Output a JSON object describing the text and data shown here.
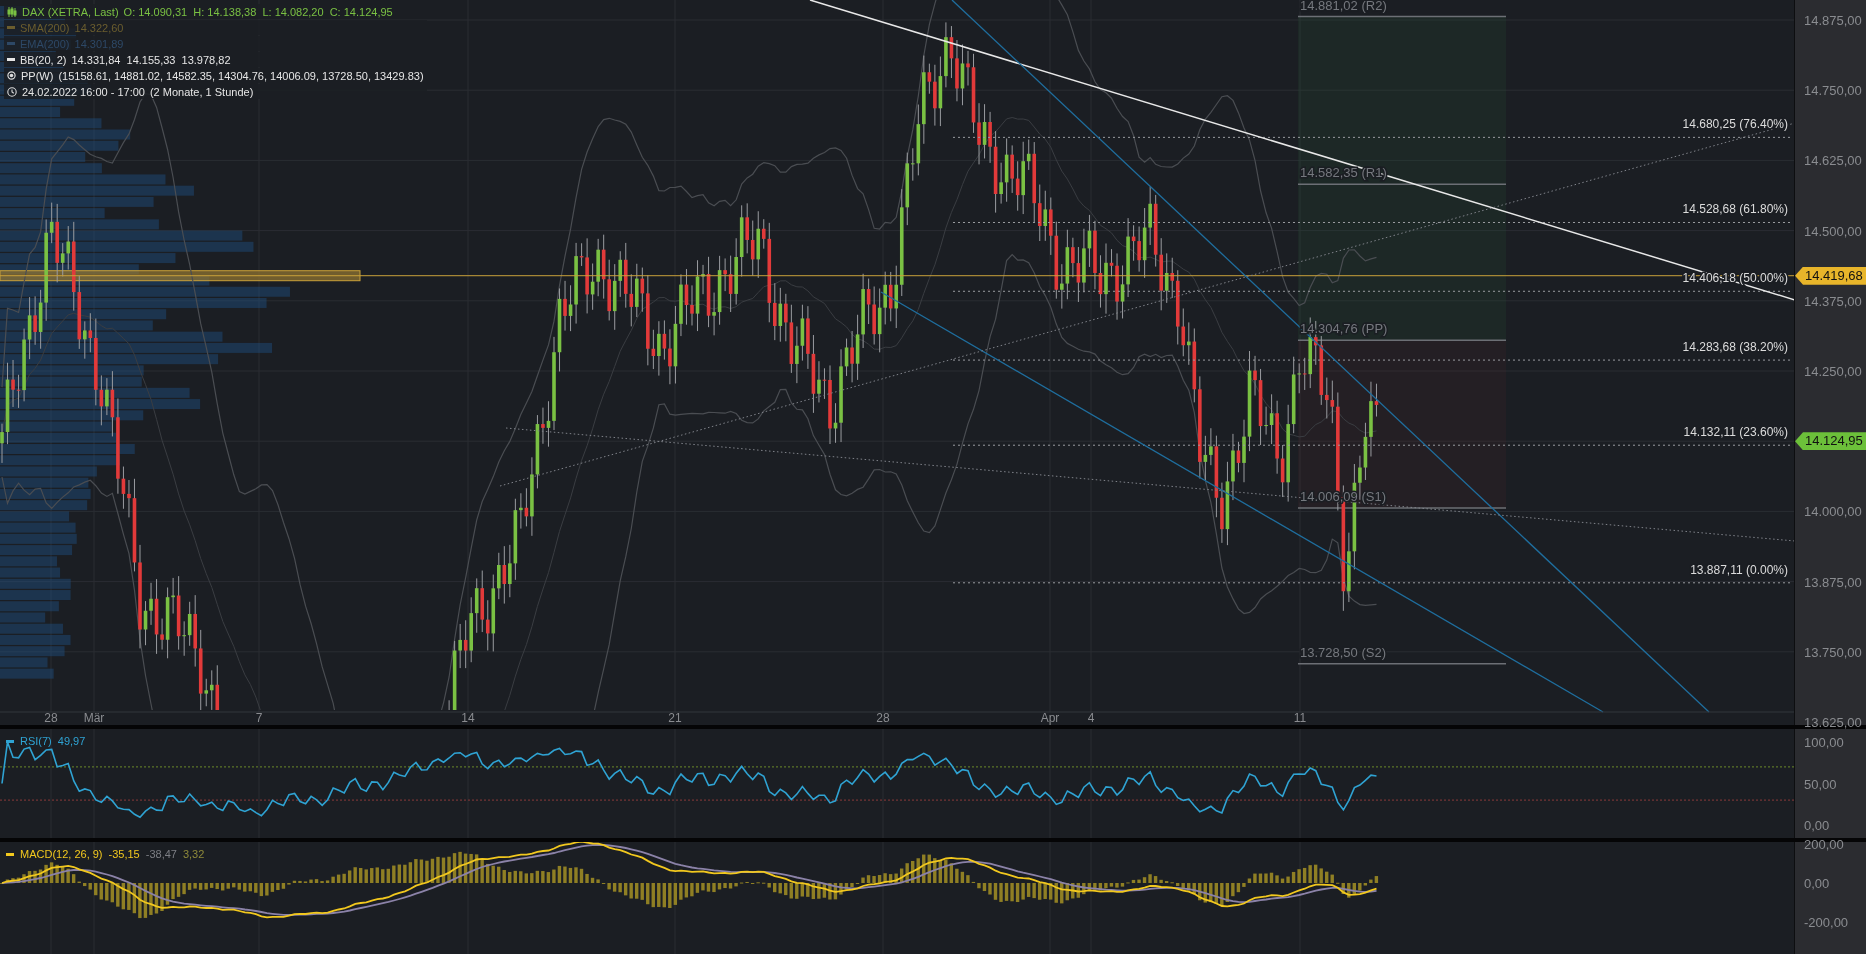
{
  "legend": [
    {
      "kind": "ohlc",
      "label": "DAX (XETRA, Last)",
      "values": "O: 14.090,31  H: 14.138,38  L: 14.082,20  C: 14.124,95",
      "color": "#7ac143"
    },
    {
      "kind": "line",
      "label": "SMA(200)",
      "values": "14.322,60",
      "color": "#6b5d2e"
    },
    {
      "kind": "line",
      "label": "EMA(200)",
      "values": "14.301,89",
      "color": "#2d4866"
    },
    {
      "kind": "line",
      "label": "BB(20, 2)",
      "values": "14.331,84  14.155,33  13.978,82",
      "color": "#e6e6e6"
    },
    {
      "kind": "pivot",
      "label": "PP(W)",
      "values": "(15158.61, 14881.02, 14582.35, 14304.76, 14006.09, 13728.50, 13429.83)"
    },
    {
      "kind": "time",
      "label": "24.02.2022 16:00 - 17:00",
      "values": "(2 Monate, 1 Stunde)"
    }
  ],
  "fib_levels": [
    "14.680,25 (76.40%)",
    "14.528,68 (61.80%)",
    "14.406,18 (50.00%)",
    "14.283,68 (38.20%)",
    "14.132,11 (23.60%)",
    "13.887,11 (0.00%)"
  ],
  "pivots": [
    "14.881,02 (R2)",
    "14.582,35 (R1)",
    "14.304,76 (PP)",
    "14.006,09 (S1)",
    "13.728,50 (S2)"
  ],
  "x_axis": [
    "28",
    "Mär",
    "7",
    "14",
    "21",
    "28",
    "Apr",
    "4",
    "11"
  ],
  "price_axis": {
    "ticks": [
      "14.875,00",
      "14.750,00",
      "14.625,00",
      "14.500,00",
      "14.375,00",
      "14.250,00",
      "14.000,00",
      "13.875,00",
      "13.750,00",
      "13.625,00"
    ],
    "tags": [
      {
        "label": "14.419,68",
        "color": "#e8b52a"
      },
      {
        "label": "14.124,95",
        "color": "#6cc03a"
      }
    ]
  },
  "rsi": {
    "label": "RSI(7)",
    "value": "49,97",
    "ticks": [
      "100,00",
      "50,00",
      "0,00"
    ]
  },
  "macd": {
    "label": "MACD(12, 26, 9)",
    "values": [
      {
        "text": "-35,15",
        "color": "#f2c81e"
      },
      {
        "text": "-38,47",
        "color": "#7d7f85"
      },
      {
        "text": "3,32",
        "color": "#8f8a3a"
      }
    ],
    "ticks": [
      "200,00",
      "0,00",
      "-200,00"
    ]
  }
}
